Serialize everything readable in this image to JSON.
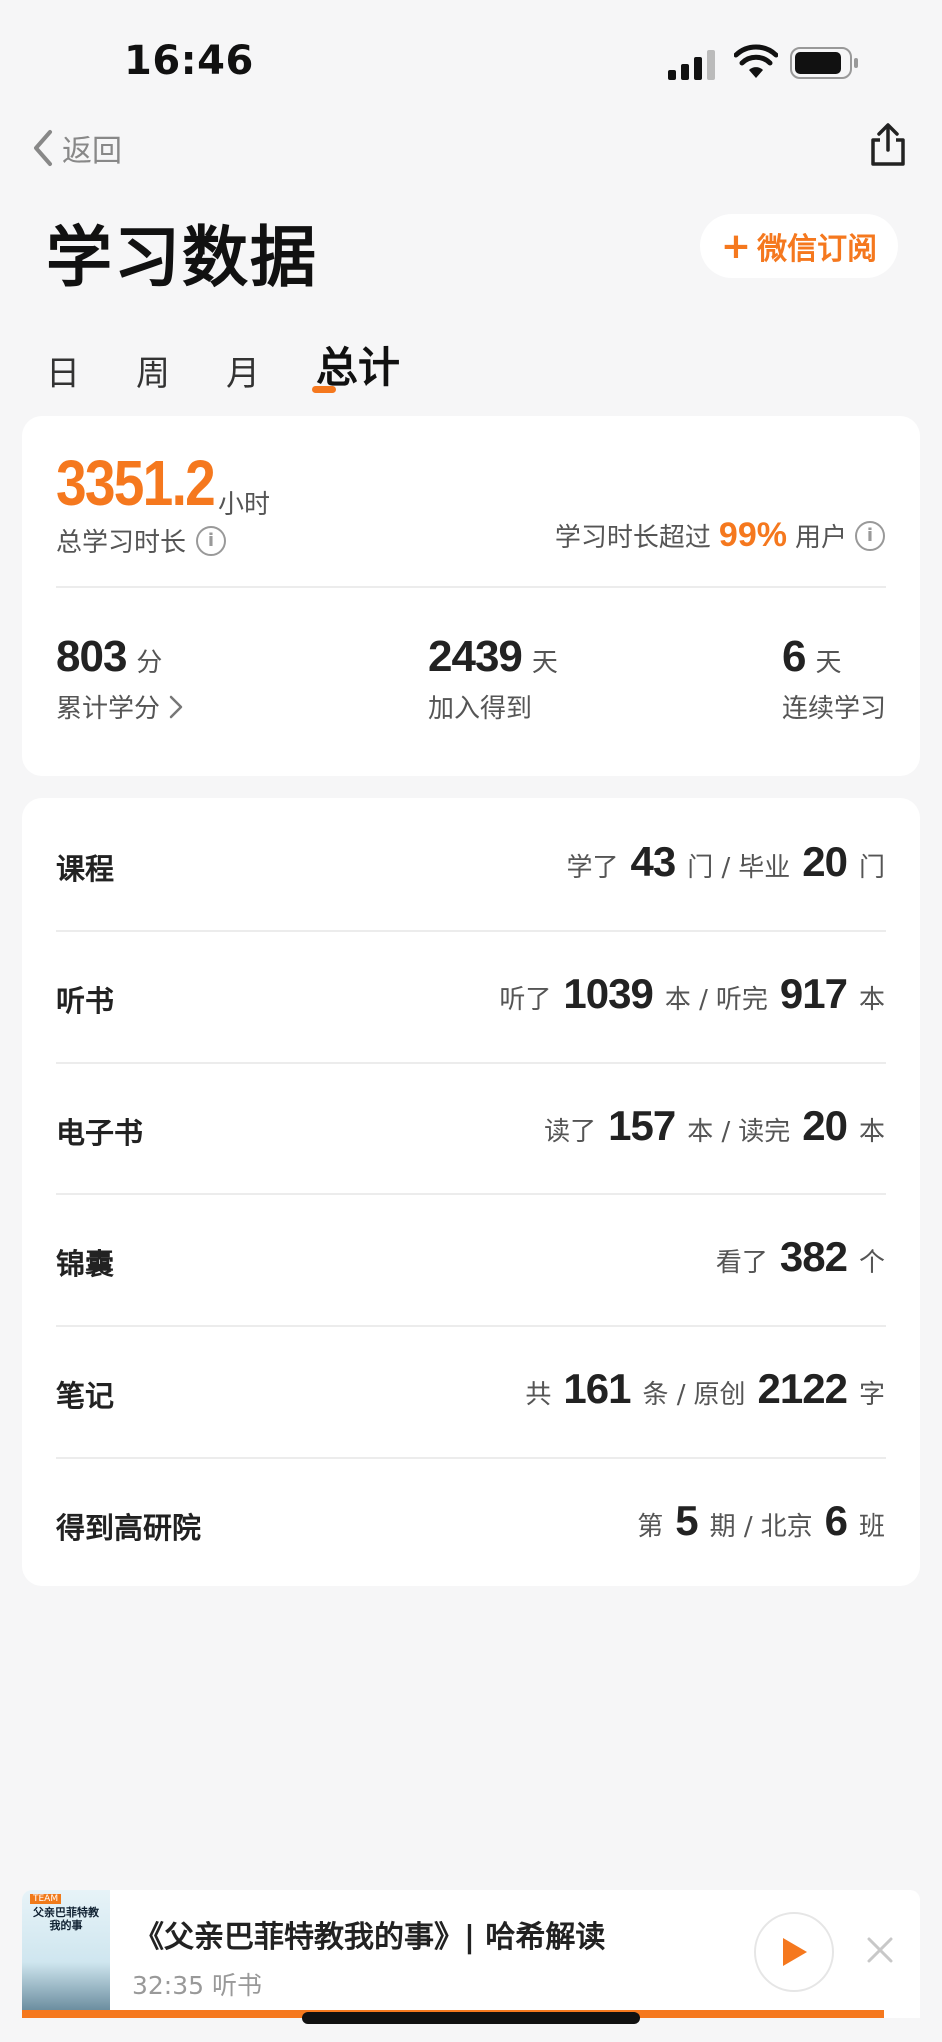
{
  "status": {
    "time": "16:46"
  },
  "nav": {
    "back_label": "返回"
  },
  "header": {
    "title": "学习数据",
    "subscribe_label": "微信订阅"
  },
  "tabs": [
    {
      "label": "日"
    },
    {
      "label": "周"
    },
    {
      "label": "月"
    },
    {
      "label": "总计",
      "active": true
    }
  ],
  "summary": {
    "total_hours": "3351.2",
    "hours_unit": "小时",
    "total_label": "总学习时长",
    "exceed_prefix": "学习时长超过",
    "exceed_percent": "99%",
    "exceed_suffix": "用户",
    "stats": [
      {
        "value": "803",
        "unit": "分",
        "label": "累计学分"
      },
      {
        "value": "2439",
        "unit": "天",
        "label": "加入得到"
      },
      {
        "value": "6",
        "unit": "天",
        "label": "连续学习"
      }
    ]
  },
  "rows": [
    {
      "label": "课程",
      "parts": [
        "学了",
        "43",
        "门 /",
        "毕业",
        "20",
        "门"
      ]
    },
    {
      "label": "听书",
      "parts": [
        "听了",
        "1039",
        "本 /",
        "听完",
        "917",
        "本"
      ]
    },
    {
      "label": "电子书",
      "parts": [
        "读了",
        "157",
        "本 /",
        "读完",
        "20",
        "本"
      ]
    },
    {
      "label": "锦囊",
      "parts": [
        "看了",
        "382",
        "个"
      ]
    },
    {
      "label": "笔记",
      "parts": [
        "共",
        "161",
        "条 /",
        "原创",
        "2122",
        "字"
      ]
    },
    {
      "label": "得到高研院",
      "parts": [
        "第",
        "5",
        "期 /",
        "北京",
        "6",
        "班"
      ]
    }
  ],
  "player": {
    "title": "《父亲巴菲特教我的事》| 哈希解读",
    "subtitle": "32:35 听书",
    "cover_tag": "TEAM",
    "cover_title": "父亲巴菲特教我的事",
    "progress": 0.96
  },
  "colors": {
    "accent": "#f5781e",
    "background": "#f6f6f7"
  }
}
